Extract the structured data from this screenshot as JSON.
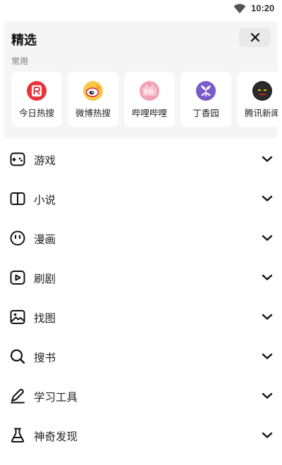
{
  "status_bar": {
    "time": "10:20",
    "wifi_icon": "wifi-icon"
  },
  "featured": {
    "title": "精选",
    "close_icon": "close-icon",
    "section_label": "常用",
    "shortcuts": [
      {
        "label": "今日热搜",
        "icon": "jinri-resou-logo-icon",
        "color": "#e8343a",
        "glyph": "R"
      },
      {
        "label": "微博热搜",
        "icon": "weibo-logo-icon",
        "color": "#f5a623",
        "glyph": ""
      },
      {
        "label": "哔哩哔哩",
        "icon": "bilibili-logo-icon",
        "color": "#f2a0b6",
        "glyph": "bili"
      },
      {
        "label": "丁香园",
        "icon": "dingxiangyuan-logo-icon",
        "color": "#7a5cc8",
        "glyph": ""
      },
      {
        "label": "腾讯新闻",
        "icon": "tencent-news-logo-icon",
        "color": "#222222",
        "glyph": ""
      }
    ]
  },
  "menu": {
    "items": [
      {
        "label": "游戏",
        "icon": "gamepad-icon"
      },
      {
        "label": "小说",
        "icon": "book-icon"
      },
      {
        "label": "漫画",
        "icon": "face-icon"
      },
      {
        "label": "刷剧",
        "icon": "play-video-icon"
      },
      {
        "label": "找图",
        "icon": "image-icon"
      },
      {
        "label": "搜书",
        "icon": "search-icon"
      },
      {
        "label": "学习工具",
        "icon": "pen-icon"
      },
      {
        "label": "神奇发现",
        "icon": "flask-icon"
      }
    ],
    "expand_icon": "chevron-down-icon"
  }
}
